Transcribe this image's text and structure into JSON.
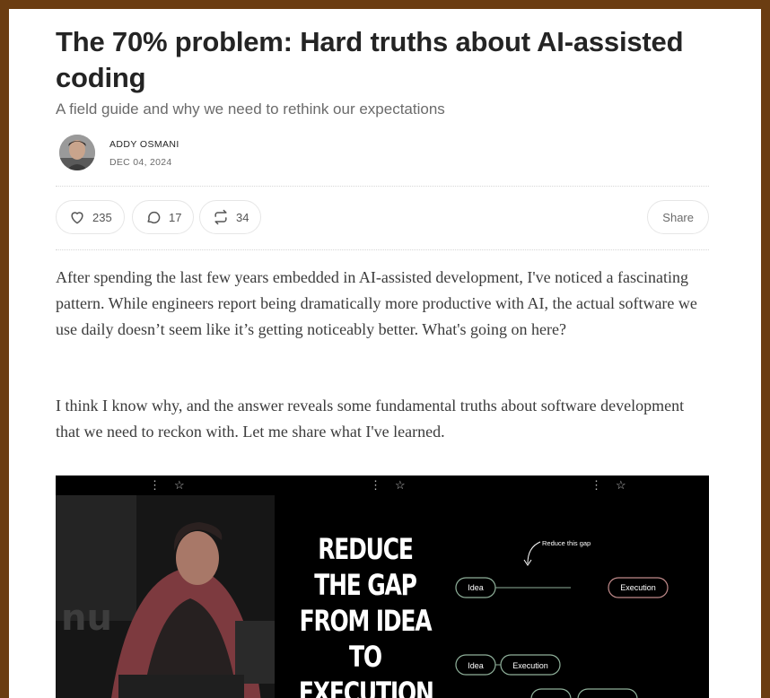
{
  "article": {
    "title": "The 70% problem: Hard truths about AI-assisted coding",
    "subtitle": "A field guide and why we need to rethink our expectations",
    "author": "ADDY OSMANI",
    "date": "DEC 04, 2024"
  },
  "actions": {
    "likes": "235",
    "comments": "17",
    "restacks": "34",
    "share_label": "Share"
  },
  "body": {
    "p1": "After spending the last few years embedded in AI-assisted development, I've noticed a fascinating pattern. While engineers report being dramatically more productive with AI, the actual software we use daily doesn’t seem like it’s getting noticeably better. What's going on here?",
    "p2": "I think I know why, and the answer reveals some fundamental truths about software development that we need to reckon with. Let me share what I've learned."
  },
  "hero_image": {
    "headline": "REDUCE THE GAP FROM IDEA TO EXECUTION",
    "diagram": {
      "annotation": "Reduce this gap",
      "node_idea": "Idea",
      "node_execution": "Execution"
    }
  },
  "colors": {
    "frame": "#6b3d12",
    "text": "#242424",
    "muted": "#6b6b6b",
    "node_green": "#7fa08a",
    "node_red": "#b87a7a"
  },
  "icons": [
    "heart-icon",
    "comment-icon",
    "restack-icon",
    "star-icon",
    "more-vertical-icon"
  ]
}
